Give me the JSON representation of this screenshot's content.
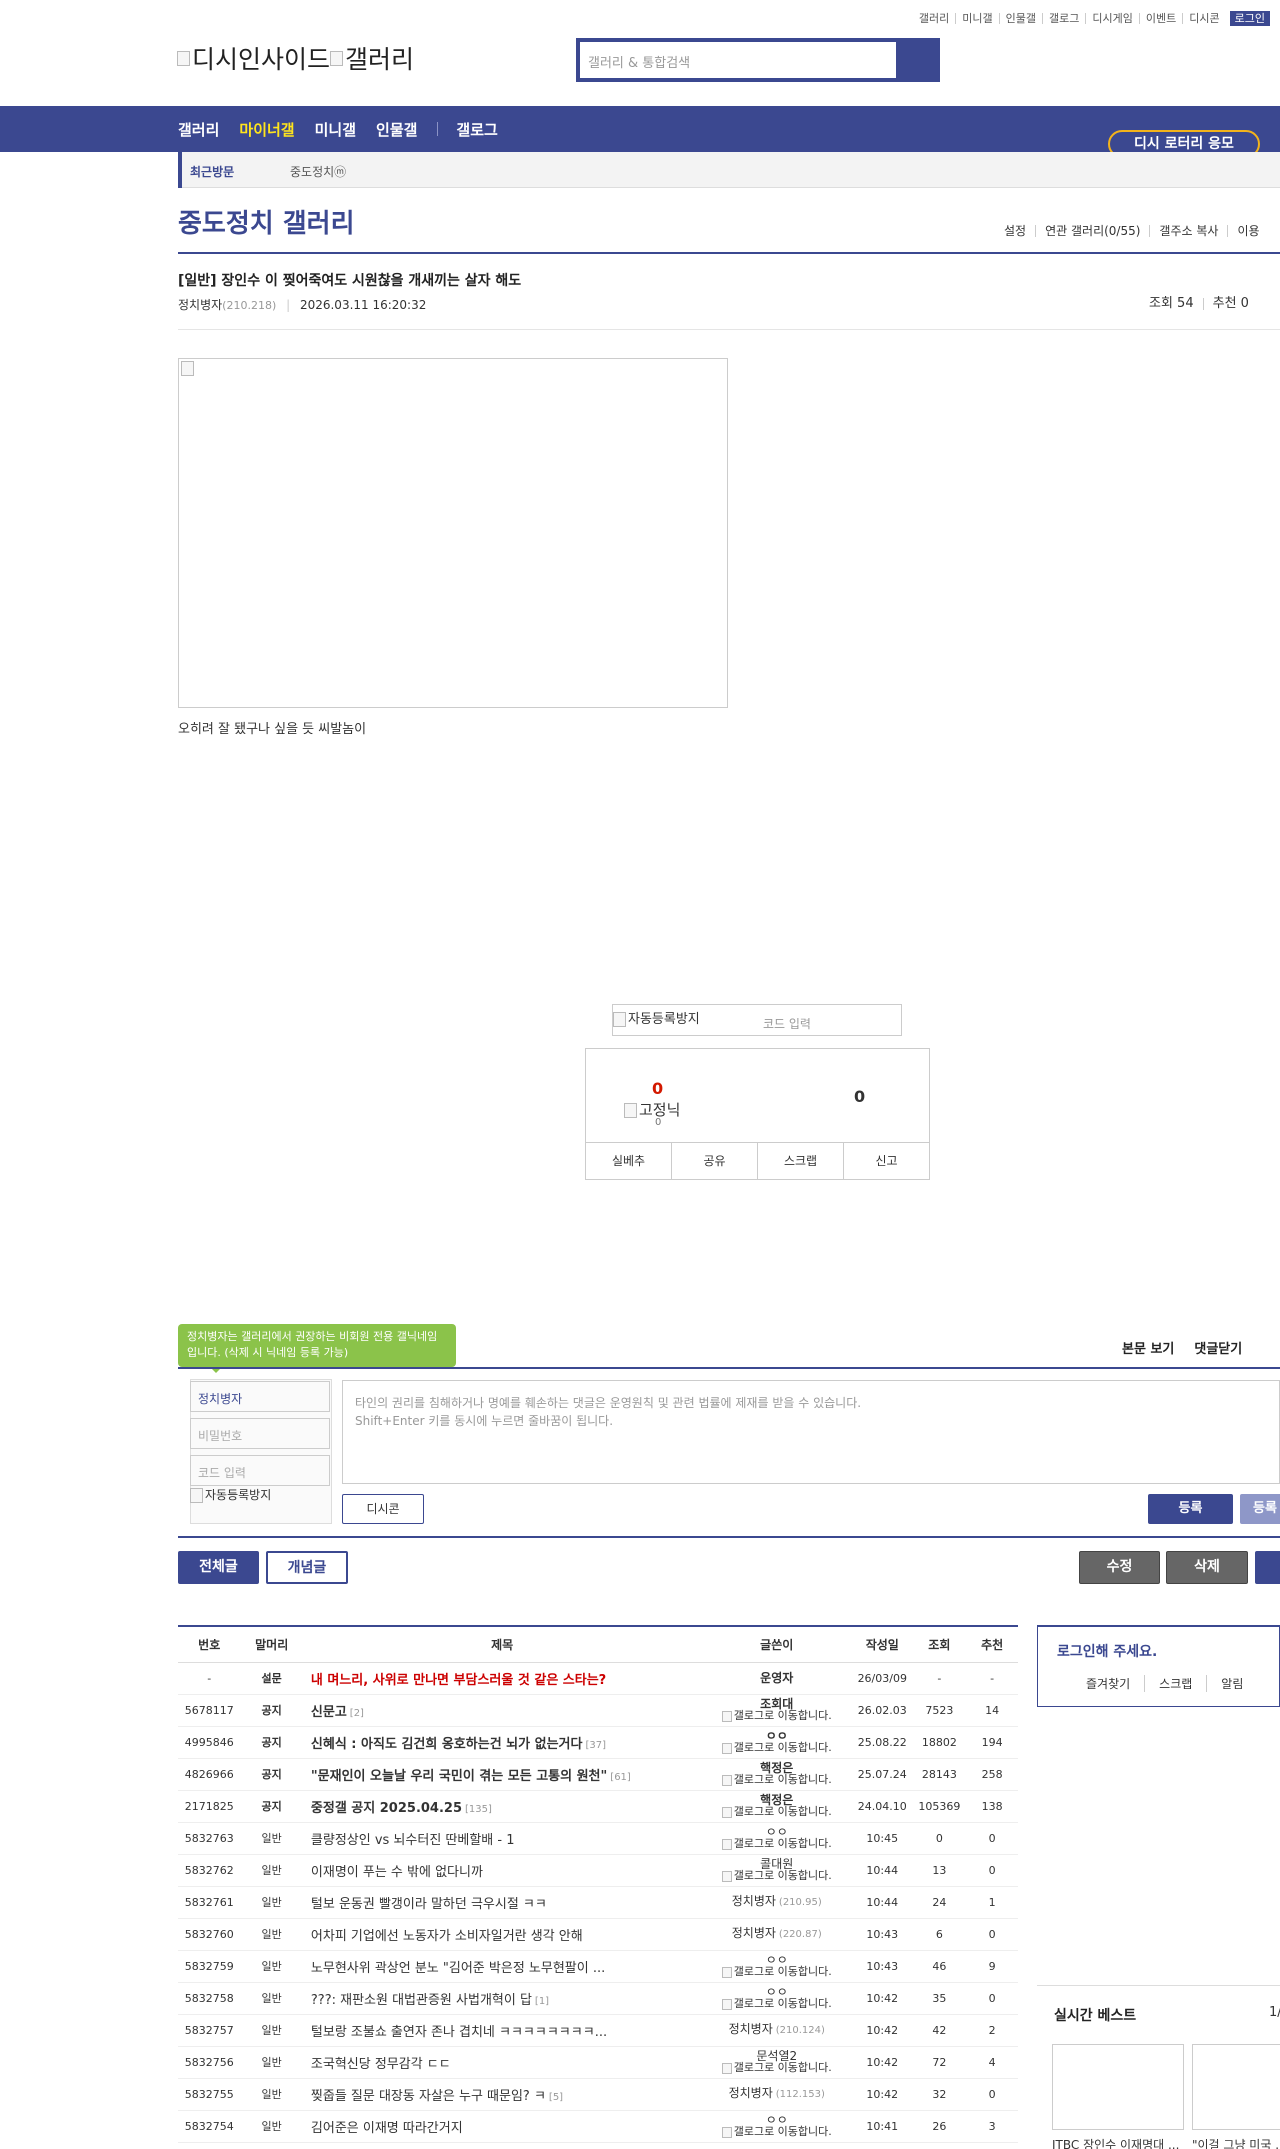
{
  "topnav": [
    "갤러리",
    "미니갤",
    "인물갤",
    "갤로그",
    "디시게임",
    "이벤트",
    "디시콘"
  ],
  "login_label": "로그인",
  "logo": {
    "part1": "디시인사이드",
    "part2": "갤러리"
  },
  "search": {
    "placeholder": "갤러리 & 통합검색"
  },
  "mainnav": {
    "items": [
      "갤러리",
      "마이너갤",
      "미니갤",
      "인물갤"
    ],
    "gallog": "갤로그"
  },
  "lotto_label": "디시 로터리 응모",
  "recent": {
    "label": "최근방문",
    "gallery": "중도정치ⓜ"
  },
  "gallery": {
    "title": "중도정치 갤러리",
    "tools": [
      "설정",
      "연관 갤러리(0/55)",
      "갤주소 복사",
      "이용"
    ]
  },
  "post": {
    "title": "[일반] 장인수 이 찢어죽여도 시원찮을 개새끼는 살자 해도",
    "author": "정치병자",
    "ip": "(210.218)",
    "date": "2026.03.11 16:20:32",
    "views": "조회 54",
    "recommends": "추천 0",
    "body": "오히려 잘 됐구나 싶을 듯 씨발놈이"
  },
  "captcha": {
    "img_alt": "자동등록방지",
    "placeholder": "코드 입력"
  },
  "vote": {
    "up": "0",
    "up_label": "고정닉",
    "up_sub": "0",
    "down": "0",
    "actions": [
      "실베추",
      "공유",
      "스크랩",
      "신고"
    ]
  },
  "comment": {
    "tip": "정치병자는 갤러리에서 권장하는 비회원 전용 갤닉네임입니다. (삭제 시 닉네임 등록 가능)",
    "links": [
      "본문 보기",
      "댓글닫기"
    ],
    "nick": "정치병자",
    "password": "비밀번호",
    "code": "코드 입력",
    "captcha_alt": "자동등록방지",
    "textarea": "타인의 권리를 침해하거나 명예를 훼손하는 댓글은 운영원칙 및 관련 법률에 제재를 받을 수 있습니다.",
    "textarea2": "Shift+Enter 키를 동시에 누르면 줄바꿈이 됩니다.",
    "dccon": "디시콘",
    "register": "등록",
    "register2": "등록"
  },
  "buttons": {
    "all": "전체글",
    "concept": "개념글",
    "edit": "수정",
    "delete": "삭제"
  },
  "table": {
    "headers": [
      "번호",
      "말머리",
      "제목",
      "글쓴이",
      "작성일",
      "조회",
      "추천"
    ],
    "rows": [
      {
        "no": "-",
        "head": "설문",
        "title": "내 며느리, 사위로 만나면 부담스러울 것 같은 스타는?",
        "rc": "",
        "writer": "운영자",
        "ip": "",
        "gallog": "",
        "date": "26/03/09",
        "views": "-",
        "rec": "-",
        "style": "survey"
      },
      {
        "no": "5678117",
        "head": "공지",
        "title": "신문고",
        "rc": "[2]",
        "writer": "조회대",
        "ip": "",
        "gallog": "갤로그로 이동합니다.",
        "date": "26.02.03",
        "views": "7523",
        "rec": "14",
        "style": "notice"
      },
      {
        "no": "4995846",
        "head": "공지",
        "title": "신혜식 : 아직도 김건희 옹호하는건 뇌가 없는거다",
        "rc": "[37]",
        "writer": "ㅇㅇ",
        "ip": "",
        "gallog": "갤로그로 이동합니다.",
        "date": "25.08.22",
        "views": "18802",
        "rec": "194",
        "style": "notice"
      },
      {
        "no": "4826966",
        "head": "공지",
        "title": "\"문재인이 오늘날 우리 국민이 겪는 모든 고통의 원천\"",
        "rc": "[61]",
        "writer": "핵정은",
        "ip": "",
        "gallog": "갤로그로 이동합니다.",
        "date": "25.07.24",
        "views": "28143",
        "rec": "258",
        "style": "notice"
      },
      {
        "no": "2171825",
        "head": "공지",
        "title": "중정갤 공지 2025.04.25",
        "rc": "[135]",
        "writer": "핵정은",
        "ip": "",
        "gallog": "갤로그로 이동합니다.",
        "date": "24.04.10",
        "views": "105369",
        "rec": "138",
        "style": "notice"
      },
      {
        "no": "5832763",
        "head": "일반",
        "title": "클량정상인 vs 뇌수터진 딴베할배 - 1",
        "rc": "",
        "writer": "ㅇㅇ",
        "ip": "",
        "gallog": "갤로그로 이동합니다.",
        "date": "10:45",
        "views": "0",
        "rec": "0",
        "style": ""
      },
      {
        "no": "5832762",
        "head": "일반",
        "title": "이재명이 푸는 수 밖에 없다니까",
        "rc": "",
        "writer": "콜대원",
        "ip": "",
        "gallog": "갤로그로 이동합니다.",
        "date": "10:44",
        "views": "13",
        "rec": "0",
        "style": ""
      },
      {
        "no": "5832761",
        "head": "일반",
        "title": "털보 운동권 빨갱이라 말하던 극우시절 ㅋㅋ",
        "rc": "",
        "writer": "정치병자",
        "ip": "(210.95)",
        "gallog": "",
        "date": "10:44",
        "views": "24",
        "rec": "1",
        "style": ""
      },
      {
        "no": "5832760",
        "head": "일반",
        "title": "어차피 기업에선 노동자가 소비자일거란 생각 안해",
        "rc": "",
        "writer": "정치병자",
        "ip": "(220.87)",
        "gallog": "",
        "date": "10:43",
        "views": "6",
        "rec": "0",
        "style": ""
      },
      {
        "no": "5832759",
        "head": "일반",
        "title": "노무현사위 곽상언 분노 \"김어준 박은정 노무현팔이 ...",
        "rc": "",
        "writer": "ㅇㅇ",
        "ip": "",
        "gallog": "갤로그로 이동합니다.",
        "date": "10:43",
        "views": "46",
        "rec": "9",
        "style": ""
      },
      {
        "no": "5832758",
        "head": "일반",
        "title": "???: 재판소원 대법관증원 사법개혁이 답",
        "rc": "[1]",
        "writer": "ㅇㅇ",
        "ip": "",
        "gallog": "갤로그로 이동합니다.",
        "date": "10:42",
        "views": "35",
        "rec": "0",
        "style": ""
      },
      {
        "no": "5832757",
        "head": "일반",
        "title": "털보랑 조불쇼 출연자 존나 겹치네 ㅋㅋㅋㅋㅋㅋㅋㅋ...",
        "rc": "",
        "writer": "정치병자",
        "ip": "(210.124)",
        "gallog": "",
        "date": "10:42",
        "views": "42",
        "rec": "2",
        "style": ""
      },
      {
        "no": "5832756",
        "head": "일반",
        "title": "조국혁신당 정무감각 ㄷㄷ",
        "rc": "",
        "writer": "문석열2",
        "ip": "",
        "gallog": "갤로그로 이동합니다.",
        "date": "10:42",
        "views": "72",
        "rec": "4",
        "style": ""
      },
      {
        "no": "5832755",
        "head": "일반",
        "title": "찢줍들 질문 대장동 자살은 누구 때문임? ㅋ",
        "rc": "[5]",
        "writer": "정치병자",
        "ip": "(112.153)",
        "gallog": "",
        "date": "10:42",
        "views": "32",
        "rec": "0",
        "style": ""
      },
      {
        "no": "5832754",
        "head": "일반",
        "title": "김어준은 이재명 따라간거지",
        "rc": "",
        "writer": "ㅇㅇ",
        "ip": "",
        "gallog": "갤로그로 이동합니다.",
        "date": "10:41",
        "views": "26",
        "rec": "3",
        "style": ""
      }
    ]
  },
  "side": {
    "login_title": "로그인해 주세요.",
    "login_links": [
      "즐겨찾기",
      "스크랩",
      "알림"
    ],
    "best_title": "실시간 베스트",
    "best_page": "1/",
    "best_cap1": "JTBC 장인수 이재명대 ...",
    "best_cap2": "\"이걸 그냥 미국 ..."
  },
  "colors": {
    "primary": "#3b4890",
    "highlight": "#ffe51c",
    "tip": "#8bc34a",
    "red": "#d31900"
  }
}
